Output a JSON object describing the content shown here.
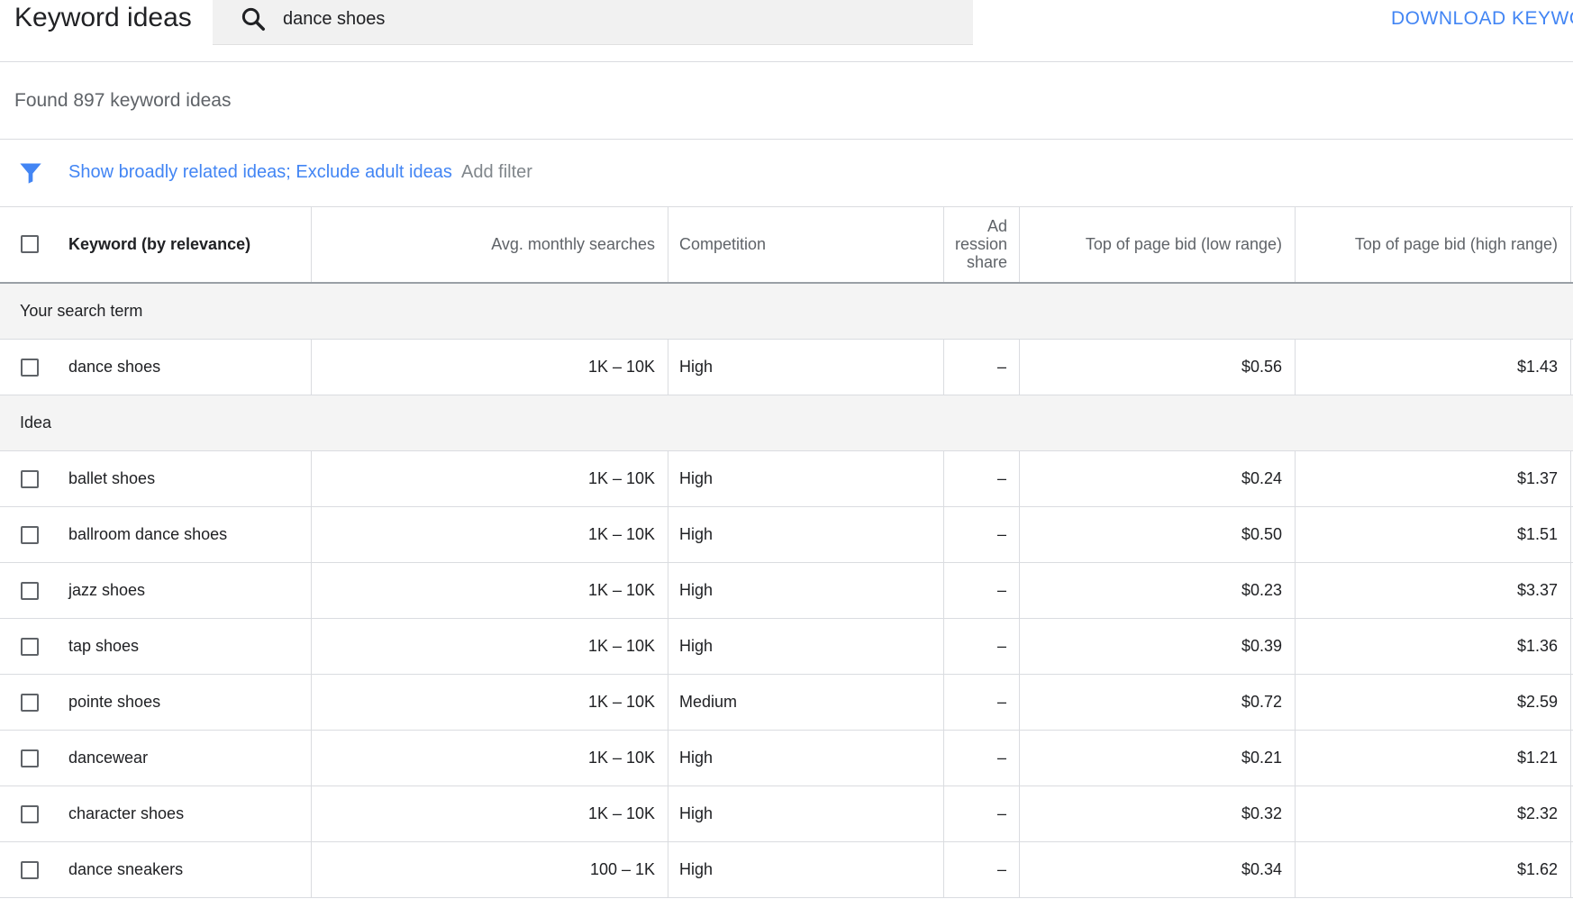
{
  "app": {
    "title": "Keyword ideas"
  },
  "search": {
    "value": "dance shoes",
    "icon": "search-icon"
  },
  "actions": {
    "download_label": "DOWNLOAD KEYWO"
  },
  "results": {
    "found_text": "Found 897 keyword ideas"
  },
  "filters": {
    "icon": "filter-icon",
    "active_text": "Show broadly related ideas; Exclude adult ideas",
    "add_label": "Add filter"
  },
  "table": {
    "columns": {
      "keyword": "Keyword (by relevance)",
      "avg_monthly_searches": "Avg. monthly searches",
      "competition": "Competition",
      "ad_impression_share": [
        "Ad",
        "ression",
        "share"
      ],
      "bid_low": "Top of page bid (low range)",
      "bid_high": "Top of page bid (high range)"
    },
    "groups": [
      {
        "label": "Your search term",
        "rows": [
          {
            "keyword": "dance shoes",
            "avg": "1K – 10K",
            "competition": "High",
            "ad_share": "–",
            "bid_low": "$0.56",
            "bid_high": "$1.43"
          }
        ]
      },
      {
        "label": "Idea",
        "rows": [
          {
            "keyword": "ballet shoes",
            "avg": "1K – 10K",
            "competition": "High",
            "ad_share": "–",
            "bid_low": "$0.24",
            "bid_high": "$1.37"
          },
          {
            "keyword": "ballroom dance shoes",
            "avg": "1K – 10K",
            "competition": "High",
            "ad_share": "–",
            "bid_low": "$0.50",
            "bid_high": "$1.51"
          },
          {
            "keyword": "jazz shoes",
            "avg": "1K – 10K",
            "competition": "High",
            "ad_share": "–",
            "bid_low": "$0.23",
            "bid_high": "$3.37"
          },
          {
            "keyword": "tap shoes",
            "avg": "1K – 10K",
            "competition": "High",
            "ad_share": "–",
            "bid_low": "$0.39",
            "bid_high": "$1.36"
          },
          {
            "keyword": "pointe shoes",
            "avg": "1K – 10K",
            "competition": "Medium",
            "ad_share": "–",
            "bid_low": "$0.72",
            "bid_high": "$2.59"
          },
          {
            "keyword": "dancewear",
            "avg": "1K – 10K",
            "competition": "High",
            "ad_share": "–",
            "bid_low": "$0.21",
            "bid_high": "$1.21"
          },
          {
            "keyword": "character shoes",
            "avg": "1K – 10K",
            "competition": "High",
            "ad_share": "–",
            "bid_low": "$0.32",
            "bid_high": "$2.32"
          },
          {
            "keyword": "dance sneakers",
            "avg": "100 – 1K",
            "competition": "High",
            "ad_share": "–",
            "bid_low": "$0.34",
            "bid_high": "$1.62"
          }
        ]
      }
    ]
  },
  "colors": {
    "accent": "#4285f4",
    "group_bg": "#f4f4f4",
    "divider": "#dadce0"
  }
}
